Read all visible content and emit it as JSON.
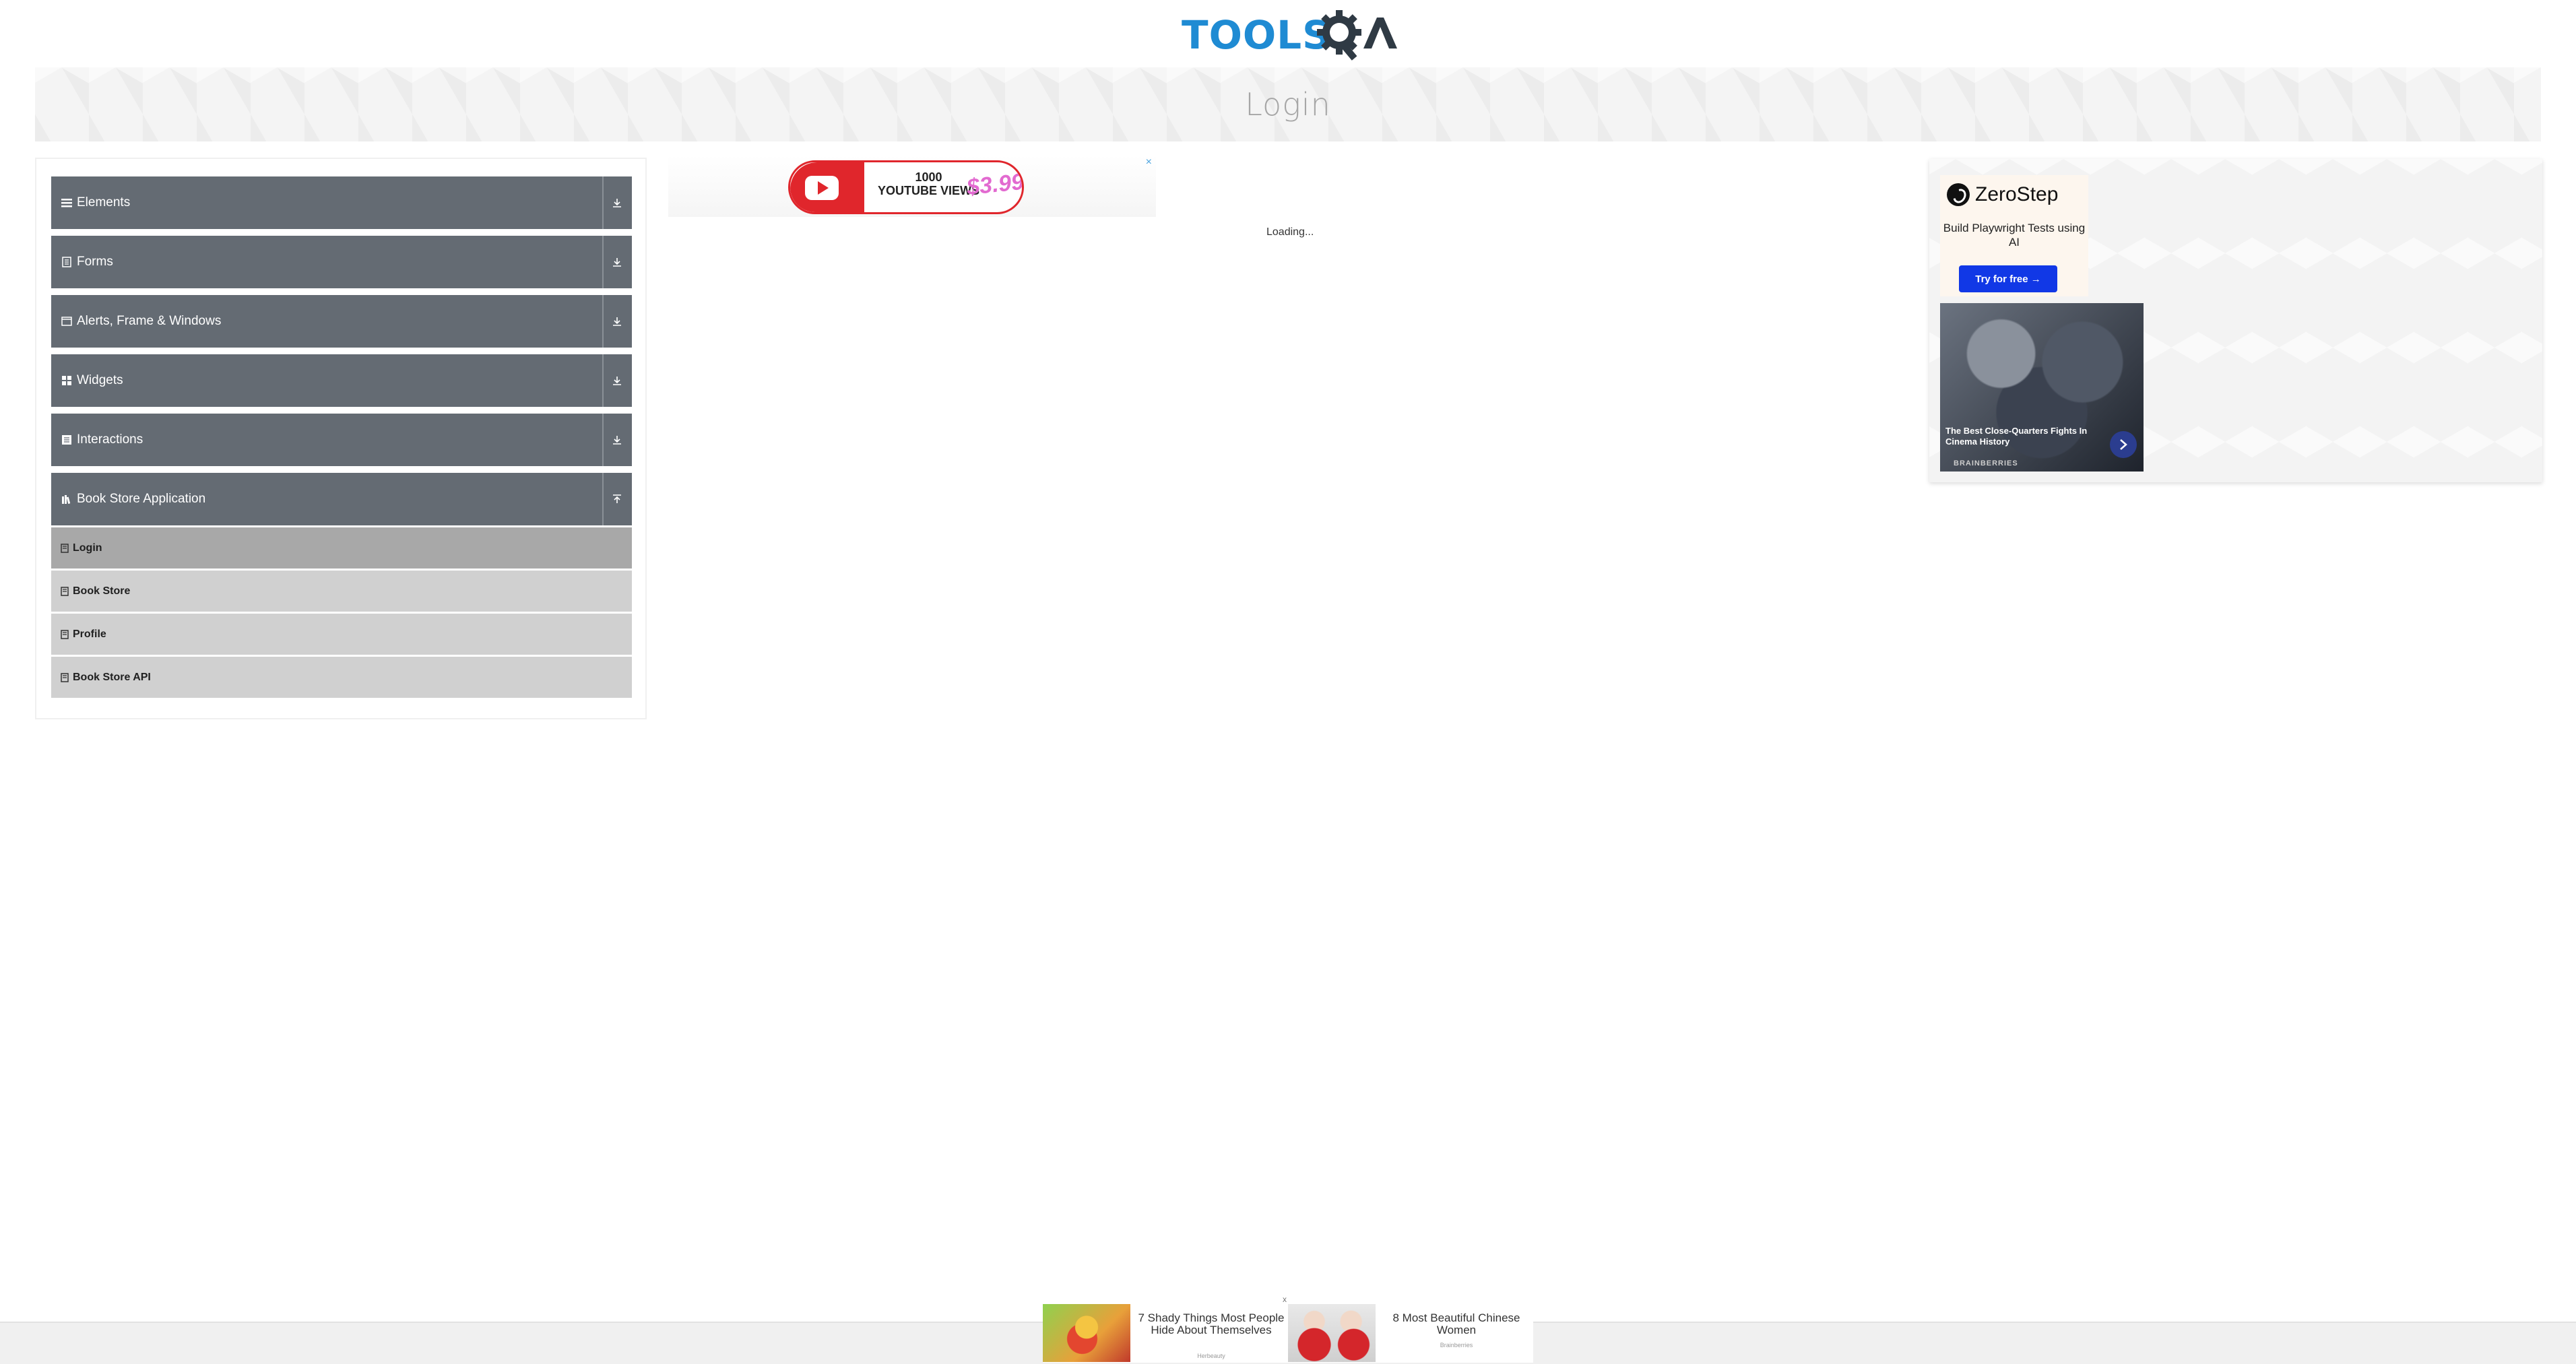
{
  "header": {
    "logo_text": "TOOLSQA",
    "page_title": "Login"
  },
  "sidebar": {
    "groups": [
      {
        "label": "Elements",
        "icon": "hamburger-icon",
        "toggle_icon": "expand-icon"
      },
      {
        "label": "Forms",
        "icon": "form-icon",
        "toggle_icon": "expand-icon"
      },
      {
        "label": "Alerts, Frame & Windows",
        "icon": "window-icon",
        "toggle_icon": "expand-icon"
      },
      {
        "label": "Widgets",
        "icon": "grid-icon",
        "toggle_icon": "expand-icon"
      },
      {
        "label": "Interactions",
        "icon": "interaction-icon",
        "toggle_icon": "expand-icon"
      },
      {
        "label": "Book Store Application",
        "icon": "book-icon",
        "toggle_icon": "collapse-icon"
      }
    ],
    "items": [
      {
        "label": "Login",
        "active": true
      },
      {
        "label": "Book Store",
        "active": false
      },
      {
        "label": "Profile",
        "active": false
      },
      {
        "label": "Book Store API",
        "active": false
      }
    ]
  },
  "center_ad": {
    "text_line1": "1000",
    "text_line2": "YOUTUBE VIEWS",
    "price": "$3.99",
    "close": "×"
  },
  "main": {
    "loading_text": "Loading..."
  },
  "right_ad": {
    "brand": "ZeroStep",
    "tagline": "Build Playwright Tests using AI",
    "cta": "Try for free →",
    "story_title": "The Best Close-Quarters Fights In Cinema History",
    "story_source": "BRAINBERRIES"
  },
  "bottom_ad": {
    "close": "x",
    "items": [
      {
        "title": "7 Shady Things Most People Hide About Themselves",
        "source": "Herbeauty"
      },
      {
        "title": "8 Most Beautiful Chinese Women",
        "source": "Brainberries"
      }
    ]
  },
  "colors": {
    "sidebar_header": "#646b73",
    "sidebar_item": "#d0d0d0",
    "sidebar_item_active": "#a8a8a8",
    "logo_blue": "#1f8bd3",
    "logo_dark": "#2f3a44",
    "cta_blue": "#1138e6"
  }
}
